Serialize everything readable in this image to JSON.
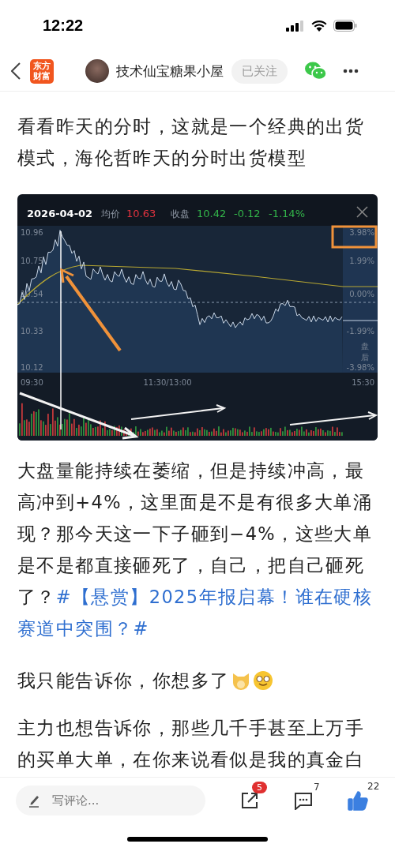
{
  "status_bar": {
    "time": "12:22"
  },
  "nav": {
    "logo_text": [
      "东方",
      "财富"
    ],
    "author": "技术仙宝糖果小屋",
    "follow": {
      "label": "已关注",
      "followed": true
    }
  },
  "article": {
    "paragraphs": [
      {
        "kind": "text",
        "text": "看看昨天的分时，这就是一个经典的出货模式，海伦哲昨天的分时出货模型"
      },
      {
        "kind": "chart_image",
        "date": "2026-04-02",
        "avg_label": "均价",
        "avg_value": "10.63",
        "close_label": "收盘",
        "close_value": "10.42",
        "change": "-0.12",
        "change_pct": "-1.14%",
        "price_ticks": [
          "10.96",
          "10.75",
          "10.54",
          "10.33",
          "10.12"
        ],
        "pct_ticks": [
          "3.98%",
          "1.99%",
          "0.00%",
          "-1.99%",
          "-3.98%"
        ],
        "after_hours": "盘后",
        "time_ticks": [
          "09:30",
          "11:30/13:00",
          "15:30"
        ]
      },
      {
        "kind": "text",
        "text": "大盘量能持续在萎缩，但是持续冲高，最高冲到+4%，这里面是不是有很多大单涌现？那今天这一下子砸到−4%，这些大单是不是都直接砸死了，自己，把自己砸死了？",
        "topic": [
          "#【悬赏】2025年报启幕！谁在硬核",
          "赛道中突围？#"
        ]
      },
      {
        "kind": "emoji_text",
        "text": "我只能告诉你，你想多了"
      },
      {
        "kind": "text",
        "text": "主力也想告诉你，那些几千手甚至上万手的买单大单，在你来说看似是我的真金白"
      }
    ]
  },
  "bottom_bar": {
    "placeholder": "写评论...",
    "share_badge": "5",
    "comment_count": "7",
    "like_count": "22",
    "liked": true
  }
}
